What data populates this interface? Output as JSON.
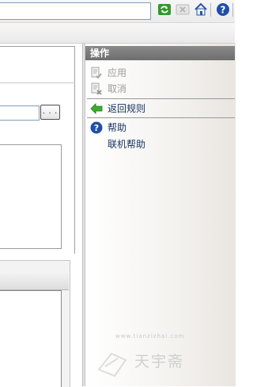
{
  "toolbar": {
    "icons": [
      "refresh-icon",
      "stop-icon",
      "home-icon",
      "help-icon"
    ]
  },
  "left": {
    "browse_label": ". . ."
  },
  "actions": {
    "header": "操作",
    "items": [
      {
        "label": "应用",
        "icon": "apply-icon",
        "enabled": false
      },
      {
        "label": "取消",
        "icon": "cancel-icon",
        "enabled": false
      },
      {
        "label": "返回规则",
        "icon": "back-arrow-icon",
        "enabled": true
      },
      {
        "label": "帮助",
        "icon": "help-icon",
        "enabled": true
      },
      {
        "label": "联机帮助",
        "icon": "",
        "enabled": true
      }
    ]
  },
  "watermark": {
    "url": "www.tianzizhai.com",
    "text": "天宇斋"
  },
  "colors": {
    "header_bg": "#7c7c7c",
    "link_text": "#15325e",
    "disabled_text": "#9c9c9c",
    "arrow_green": "#3cae2b",
    "help_blue": "#1f4fa8"
  }
}
